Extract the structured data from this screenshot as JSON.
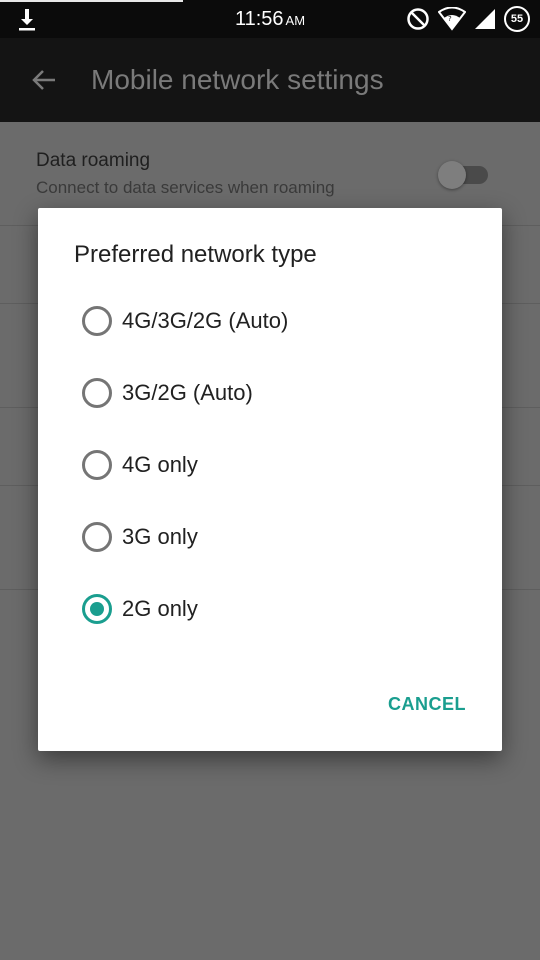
{
  "status_bar": {
    "time": "11:56",
    "ampm": "AM",
    "battery_level": "55",
    "download_progress": 0.34,
    "icons": [
      "download-icon",
      "do-not-disturb-icon",
      "wifi-icon",
      "cell-signal-icon",
      "battery-icon"
    ]
  },
  "app_bar": {
    "title": "Mobile network settings",
    "back_icon": "arrow-back-icon"
  },
  "settings": {
    "data_roaming": {
      "title": "Data roaming",
      "subtitle": "Connect to data services when roaming",
      "enabled": false
    }
  },
  "dialog": {
    "title": "Preferred network type",
    "options": [
      {
        "label": "4G/3G/2G (Auto)",
        "selected": false
      },
      {
        "label": "3G/2G (Auto)",
        "selected": false
      },
      {
        "label": "4G only",
        "selected": false
      },
      {
        "label": "3G only",
        "selected": false
      },
      {
        "label": "2G only",
        "selected": true
      }
    ],
    "cancel_label": "CANCEL"
  },
  "colors": {
    "accent": "#1a9e8f",
    "status_bar_bg": "#0b0b0b",
    "app_bar_bg": "#141414",
    "scrim_bg": "#6b6b6b"
  }
}
